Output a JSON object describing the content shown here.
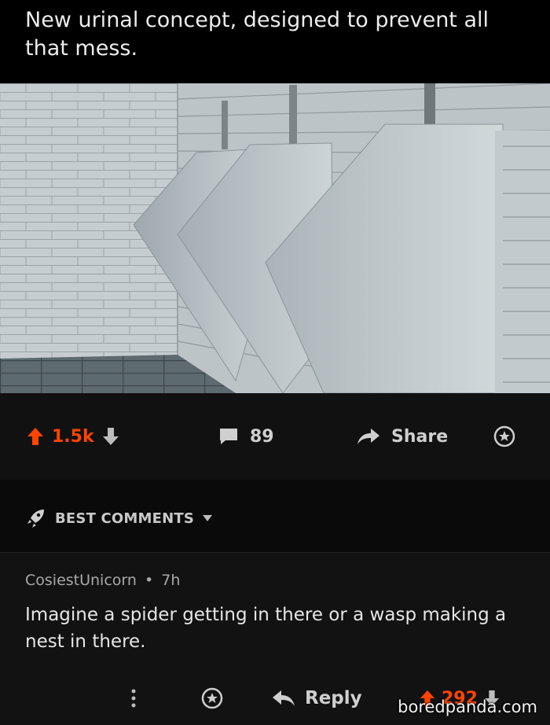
{
  "post": {
    "title": "New urinal concept, designed to prevent all that mess.",
    "image_description_icon": "urinal-photo"
  },
  "actions": {
    "score": "1.5k",
    "comments_count": "89",
    "share_label": "Share"
  },
  "sort": {
    "label": "BEST COMMENTS"
  },
  "comment": {
    "author": "CosiestUnicorn",
    "separator": "•",
    "time": "7h",
    "text": "Imagine a spider getting in there or a wasp making a nest in there.",
    "reply_label": "Reply",
    "score": "292"
  },
  "watermark": "boredpanda.com",
  "colors": {
    "upvote": "#ff4500",
    "background": "#000000",
    "bar": "#111112"
  }
}
